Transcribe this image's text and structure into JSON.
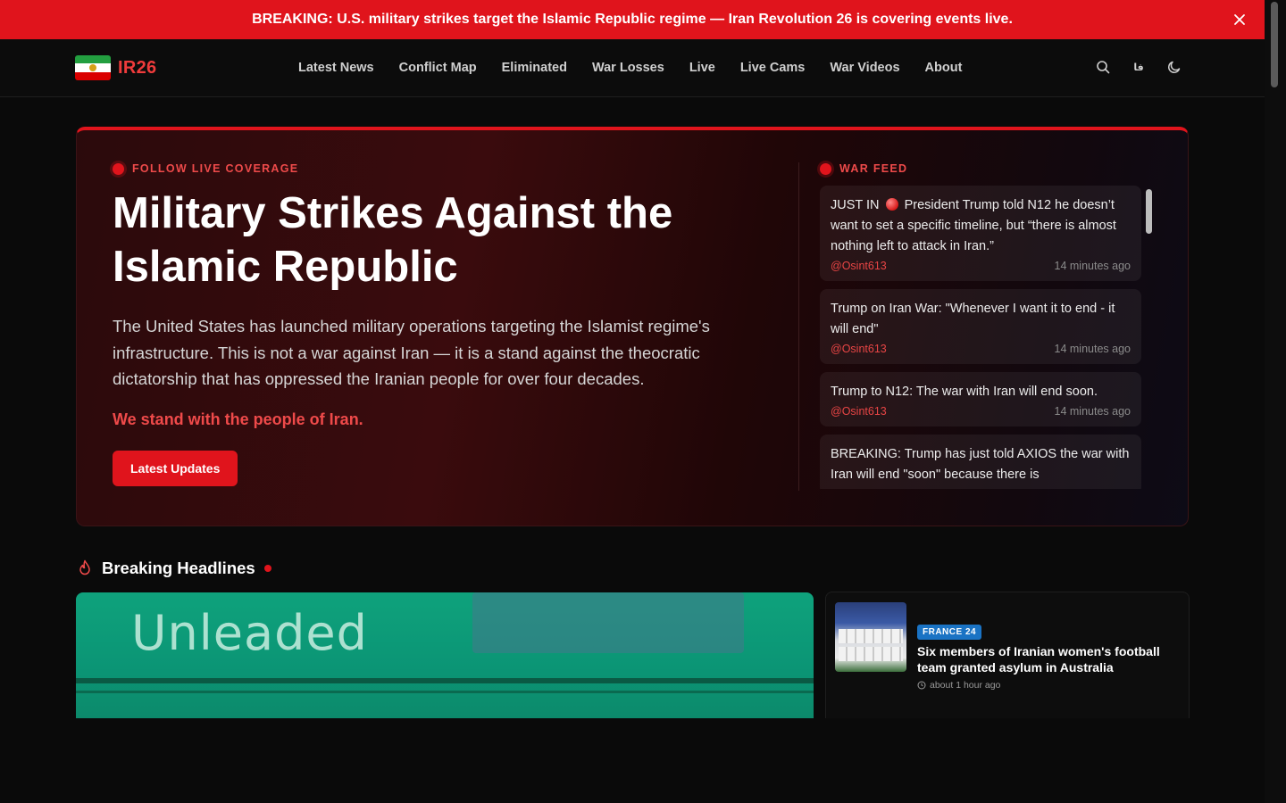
{
  "banner": {
    "text": "BREAKING: U.S. military strikes target the Islamic Republic regime — Iran Revolution 26 is covering events live."
  },
  "nav": {
    "logo_text": "IR26",
    "links": [
      "Latest News",
      "Conflict Map",
      "Eliminated",
      "War Losses",
      "Live",
      "Live Cams",
      "War Videos",
      "About"
    ],
    "lang_label": "فا"
  },
  "hero": {
    "eyebrow": "FOLLOW LIVE COVERAGE",
    "title_line1": "Military Strikes Against the",
    "title_line2": "Islamic Republic",
    "description": "The United States has launched military operations targeting the Islamist regime's infrastructure. This is not a war against Iran — it is a stand against the theocratic dictatorship that has oppressed the Iranian people for over four decades.",
    "tagline": "We stand with the people of Iran.",
    "button": "Latest Updates"
  },
  "feed": {
    "title": "WAR FEED",
    "items": [
      {
        "prefix": "JUST IN",
        "text": "President Trump told N12 he doesn’t want to set a specific timeline, but “there is almost nothing left to attack in Iran.”",
        "source": "@Osint613",
        "time": "14 minutes ago"
      },
      {
        "text": "Trump on Iran War: \"Whenever I want it to end - it will end\"",
        "source": "@Osint613",
        "time": "14 minutes ago"
      },
      {
        "text": "Trump to N12: The war with Iran will end soon.",
        "source": "@Osint613",
        "time": "14 minutes ago"
      },
      {
        "text": "BREAKING: Trump has just told AXIOS the war with Iran will end \"soon\" because there is",
        "source": "",
        "time": ""
      }
    ]
  },
  "headlines": {
    "title": "Breaking Headlines",
    "big_card_image_text": "Unleaded",
    "side_card": {
      "badge": "FRANCE 24",
      "title": "Six members of Iranian women's football team granted asylum in Australia",
      "time": "about 1 hour ago"
    }
  },
  "colors": {
    "accent": "#e0141c",
    "accent_text": "#ef4a4a",
    "badge_blue": "#1a73c4"
  }
}
